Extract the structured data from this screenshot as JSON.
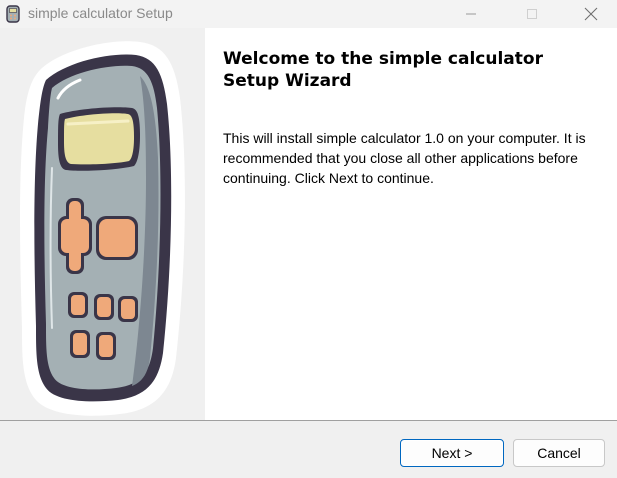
{
  "window": {
    "title": "simple calculator Setup",
    "app_icon": "calculator-icon",
    "controls": {
      "minimize_icon": "minimize-icon",
      "maximize_icon": "maximize-icon",
      "close_icon": "close-icon"
    }
  },
  "sidebar": {
    "image": "calculator-illustration",
    "colors": {
      "outline": "#3a3548",
      "body": "#a4b0b4",
      "screen": "#e6dea0",
      "keys": "#efa97a",
      "highlight": "#ffffff"
    }
  },
  "content": {
    "heading": "Welcome to the simple calculator Setup Wizard",
    "body": "This will install simple calculator 1.0 on your computer. It is recommended that you close all other applications before continuing. Click Next to continue."
  },
  "footer": {
    "next_label": "Next >",
    "cancel_label": "Cancel"
  },
  "colors": {
    "accent": "#0067c0",
    "panel_bg": "#f0f0f0",
    "content_bg": "#ffffff"
  }
}
